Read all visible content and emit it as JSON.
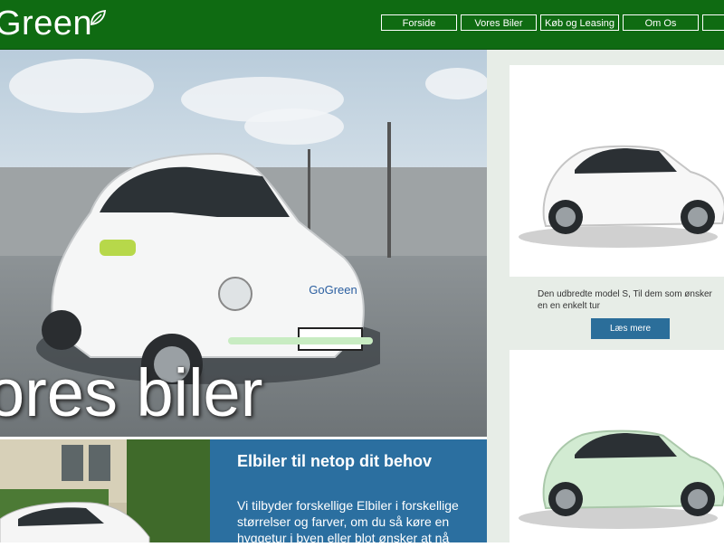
{
  "brand": {
    "logo_text": "Green"
  },
  "nav": {
    "items": [
      "Forside",
      "Vores Biler",
      "Køb og Leasing",
      "Om Os",
      ""
    ]
  },
  "hero": {
    "title": "ores biler",
    "plate": "GoGreen"
  },
  "info": {
    "title": "Elbiler til netop dit behov",
    "body": "Vi tilbyder forskellige Elbiler i forskellige størrelser og farver, om du så køre en hyggetur i byen eller blot ønsker at nå"
  },
  "sidebar": {
    "card1": {
      "text": "Den udbredte model S, Til dem som ønsker en en enkelt tur",
      "button": "Læs mere"
    }
  },
  "colors": {
    "header": "#0f6b12",
    "accent_blue": "#2b6fa0",
    "mint_car": "#cfe8cf"
  }
}
